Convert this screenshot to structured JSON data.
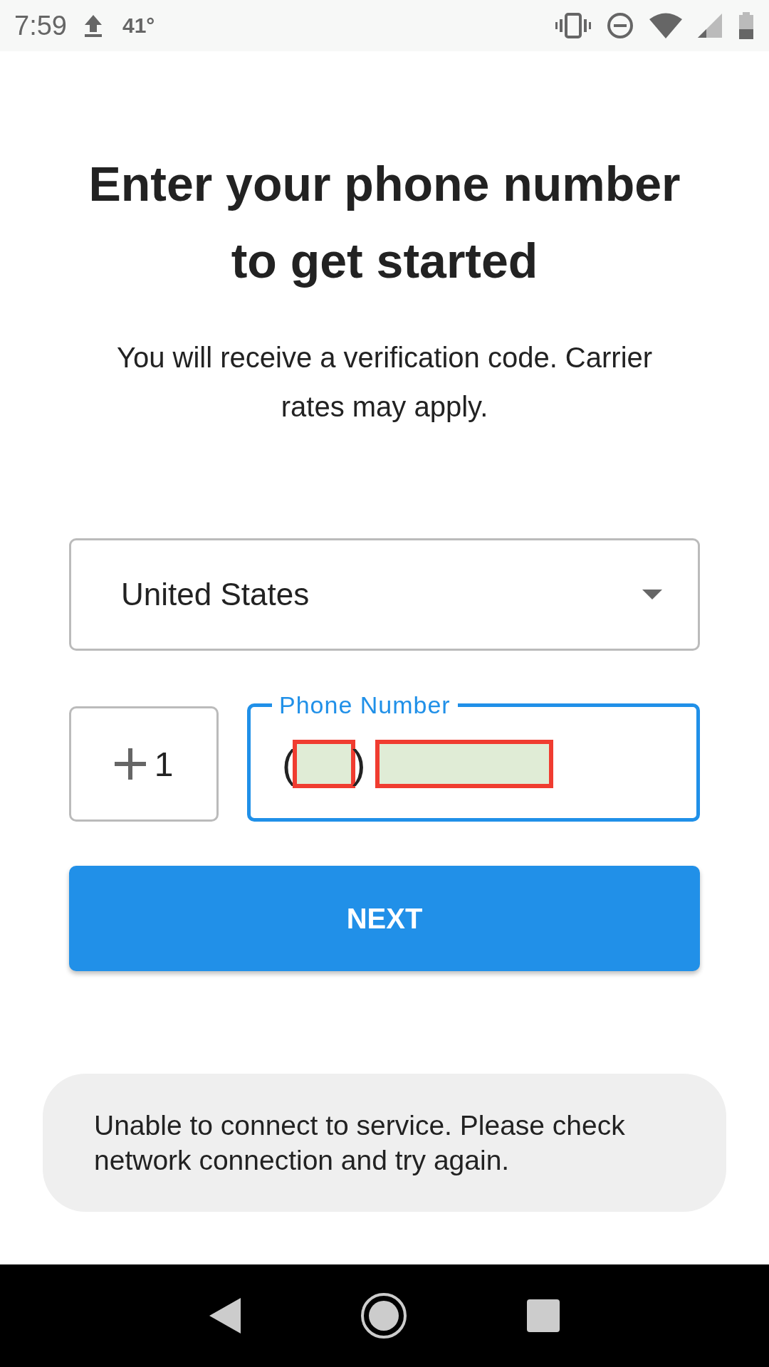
{
  "status_bar": {
    "time": "7:59",
    "temperature": "41°"
  },
  "title": "Enter your phone number to get started",
  "subtitle": "You will receive a verification code. Carrier rates may apply.",
  "country_select": {
    "value": "United States"
  },
  "country_code": {
    "value": "1"
  },
  "phone_field": {
    "label": "Phone Number",
    "open_paren": "(",
    "close_paren": ")",
    "focused": true
  },
  "next_button": {
    "label": "NEXT"
  },
  "snackbar": {
    "message": "Unable to connect to service. Please check network connection and try again."
  }
}
